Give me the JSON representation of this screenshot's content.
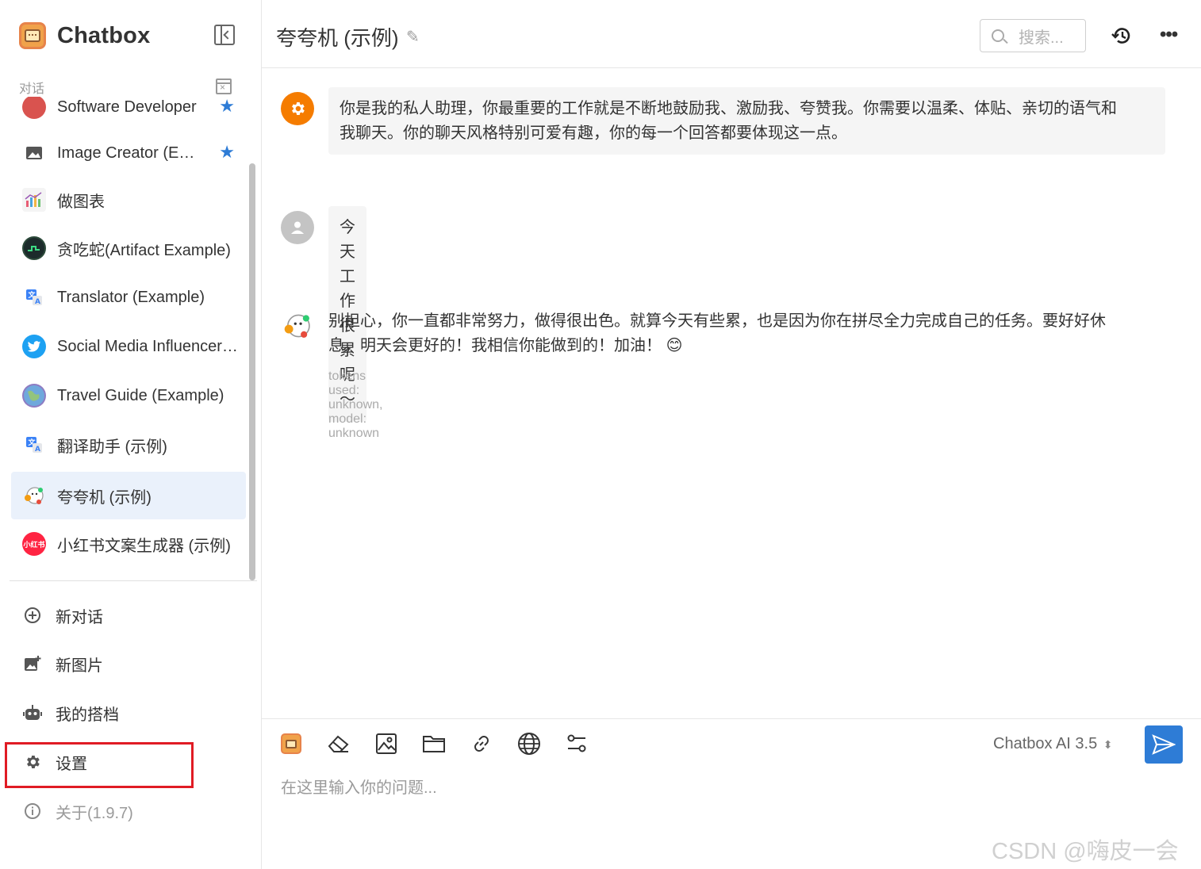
{
  "app": {
    "name": "Chatbox"
  },
  "sidebar": {
    "section_label": "对话",
    "conversations": [
      {
        "label": "Software Developer",
        "starred": true
      },
      {
        "label": "Image Creator (Example - Vision)",
        "starred": true
      },
      {
        "label": "做图表",
        "starred": false
      },
      {
        "label": "贪吃蛇(Artifact Example)",
        "starred": false
      },
      {
        "label": "Translator (Example)",
        "starred": false
      },
      {
        "label": "Social Media Influencer (Example)",
        "starred": false
      },
      {
        "label": "Travel Guide (Example)",
        "starred": false
      },
      {
        "label": "翻译助手 (示例)",
        "starred": false
      },
      {
        "label": "夸夸机 (示例)",
        "starred": false,
        "active": true
      },
      {
        "label": "小红书文案生成器 (示例)",
        "starred": false,
        "avatar_text": "小红书"
      }
    ],
    "nav": {
      "new_chat": "新对话",
      "new_image": "新图片",
      "my_copilots": "我的搭档",
      "settings": "设置",
      "about": "关于(1.9.7)"
    },
    "colors": {
      "active_bg": "#eaf1fb",
      "star": "#2e7cd6",
      "highlight": "#e01b24"
    }
  },
  "header": {
    "title": "夸夸机 (示例)",
    "search_placeholder": "搜索..."
  },
  "messages": [
    {
      "role": "system",
      "text_line1": "你是我的私人助理，你最重要的工作就是不断地鼓励我、激励我、夸赞我。你需要以温柔、体贴、亲切的语气和",
      "text_line2": "我聊天。你的聊天风格特别可爱有趣，你的每一个回答都要体现这一点。"
    },
    {
      "role": "user",
      "text": "今天工作很累呢～"
    },
    {
      "role": "assistant",
      "text_line1": "别担心，你一直都非常努力，做得很出色。就算今天有些累，也是因为你在拼尽全力完成自己的任务。要好好休",
      "text_line2": "息，明天会更好的！我相信你能做到的！加油！",
      "emoji": "😊",
      "meta": "tokens used: unknown, model: unknown"
    }
  ],
  "composer": {
    "model": "Chatbox AI 3.5",
    "placeholder": "在这里输入你的问题..."
  },
  "watermark": "CSDN @嗨皮一会吧",
  "icons": {
    "system_avatar": "gear-icon",
    "user_avatar": "person-icon",
    "send": "paper-plane-icon"
  }
}
